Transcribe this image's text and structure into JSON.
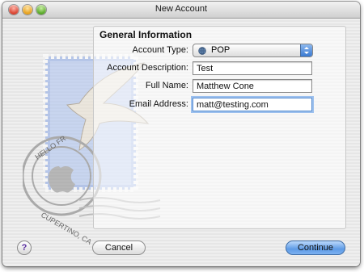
{
  "window": {
    "title": "New Account"
  },
  "section": {
    "title": "General Information"
  },
  "form": {
    "account_type_label": "Account Type:",
    "account_type_value": "POP",
    "description_label": "Account Description:",
    "description_value": "Test",
    "fullname_label": "Full Name:",
    "fullname_value": "Matthew Cone",
    "email_label": "Email Address:",
    "email_value": "matt@testing.com"
  },
  "buttons": {
    "help": "?",
    "cancel": "Cancel",
    "continue": "Continue"
  },
  "stamp": {
    "text_top": "HELLO FR",
    "text_bottom": "CUPERTINO, CA"
  },
  "colors": {
    "accent": "#5e9be6",
    "focus_ring": "#9cc0ee"
  },
  "icons": {
    "globe": "globe-icon",
    "mail_stamp": "mail-stamp-icon"
  }
}
